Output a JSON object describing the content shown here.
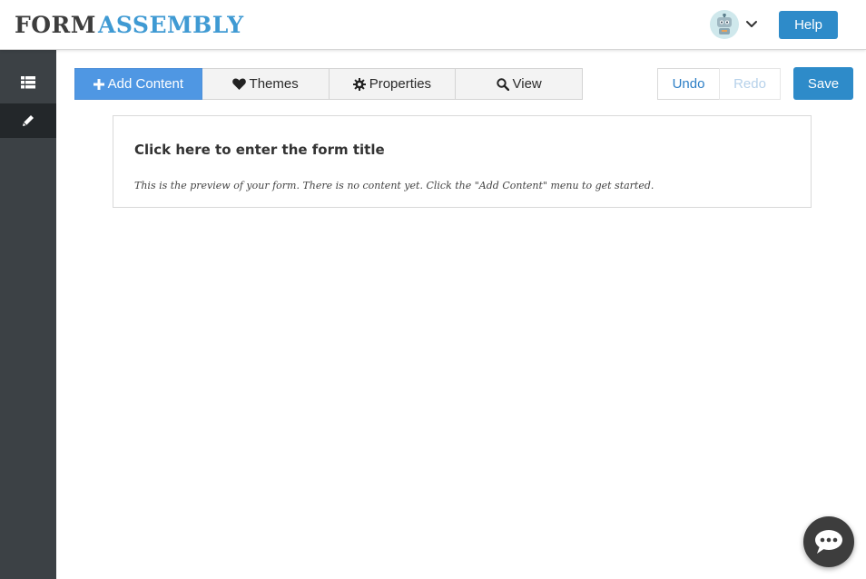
{
  "header": {
    "logo_part1": "FORM",
    "logo_part2": "ASSEMBLY",
    "avatar_icon": "robot-avatar-icon",
    "help_label": "Help"
  },
  "sidebar": {
    "items": [
      {
        "icon": "list-icon",
        "active": false
      },
      {
        "icon": "pencil-icon",
        "active": true
      }
    ]
  },
  "toolbar": {
    "tabs": [
      {
        "label": "Add Content",
        "icon": "plus-icon"
      },
      {
        "label": "Themes",
        "icon": "heart-icon"
      },
      {
        "label": "Properties",
        "icon": "gear-icon"
      },
      {
        "label": "View",
        "icon": "search-icon"
      }
    ],
    "undo_label": "Undo",
    "redo_label": "Redo",
    "save_label": "Save"
  },
  "preview": {
    "title": "Click here to enter the form title",
    "description": "This is the preview of your form. There is no content yet. Click the \"Add Content\" menu to get started."
  },
  "colors": {
    "accent": "#2e8bc9",
    "sidebar": "#3c4145",
    "sidebar_active": "#23272a",
    "active_tab": "#4f97e3"
  },
  "chat": {
    "icon": "chat-bubble-icon"
  }
}
